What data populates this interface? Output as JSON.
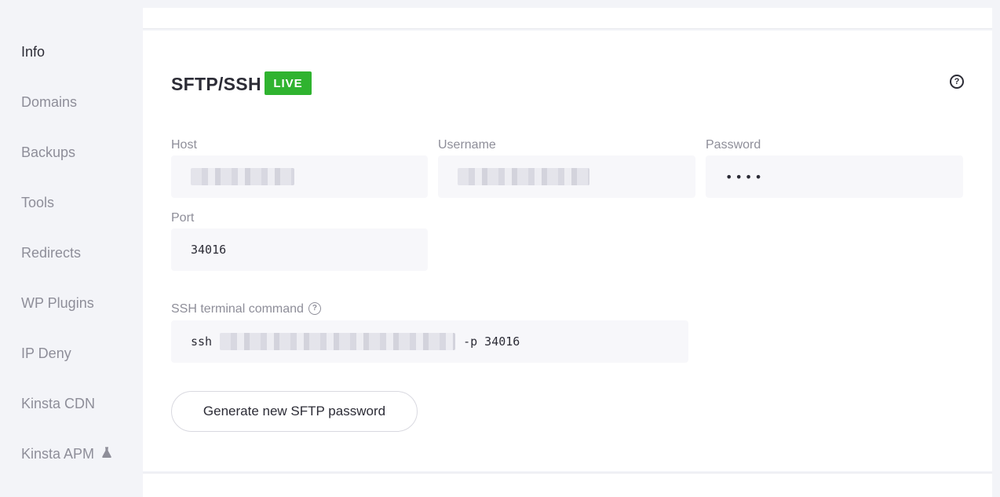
{
  "sidebar": {
    "items": [
      {
        "label": "Info",
        "active": true
      },
      {
        "label": "Domains"
      },
      {
        "label": "Backups"
      },
      {
        "label": "Tools"
      },
      {
        "label": "Redirects"
      },
      {
        "label": "WP Plugins"
      },
      {
        "label": "IP Deny"
      },
      {
        "label": "Kinsta CDN"
      },
      {
        "label": "Kinsta APM",
        "icon": "flask-icon"
      }
    ]
  },
  "section": {
    "title": "SFTP/SSH",
    "badge": "LIVE",
    "badge_color": "#2fb32f",
    "help_icon": "?"
  },
  "fields": {
    "host_label": "Host",
    "username_label": "Username",
    "password_label": "Password",
    "password_value": "••••",
    "port_label": "Port",
    "port_value": "34016",
    "ssh_label": "SSH terminal command",
    "ssh_prefix": "ssh",
    "ssh_suffix": "-p 34016"
  },
  "actions": {
    "generate_label": "Generate new SFTP password"
  }
}
